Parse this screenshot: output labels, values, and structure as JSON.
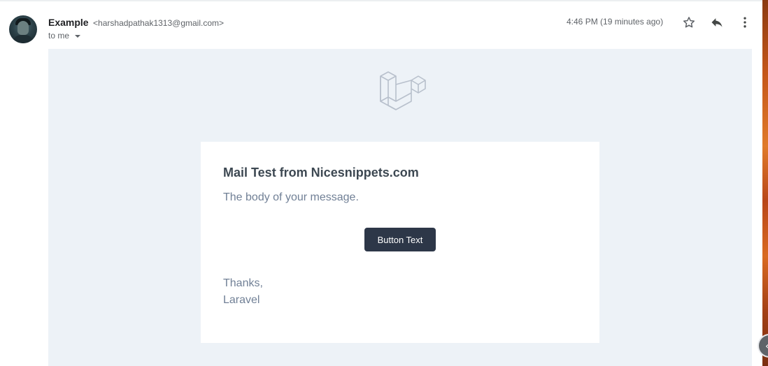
{
  "header": {
    "sender_name": "Example",
    "sender_email": "<harshadpathak1313@gmail.com>",
    "recipient_label": "to me",
    "timestamp": "4:46 PM (19 minutes ago)",
    "icons": [
      "star-icon",
      "reply-icon",
      "more-vert-icon"
    ]
  },
  "email": {
    "logo": "laravel-logo",
    "title": "Mail Test from Nicesnippets.com",
    "body": "The body of your message.",
    "button_label": "Button Text",
    "signoff": "Thanks,",
    "signature": "Laravel"
  },
  "colors": {
    "mail_background": "#edf2f7",
    "card_background": "#ffffff",
    "button_background": "#2d3748",
    "title_text": "#3d4852",
    "body_text": "#718096"
  }
}
